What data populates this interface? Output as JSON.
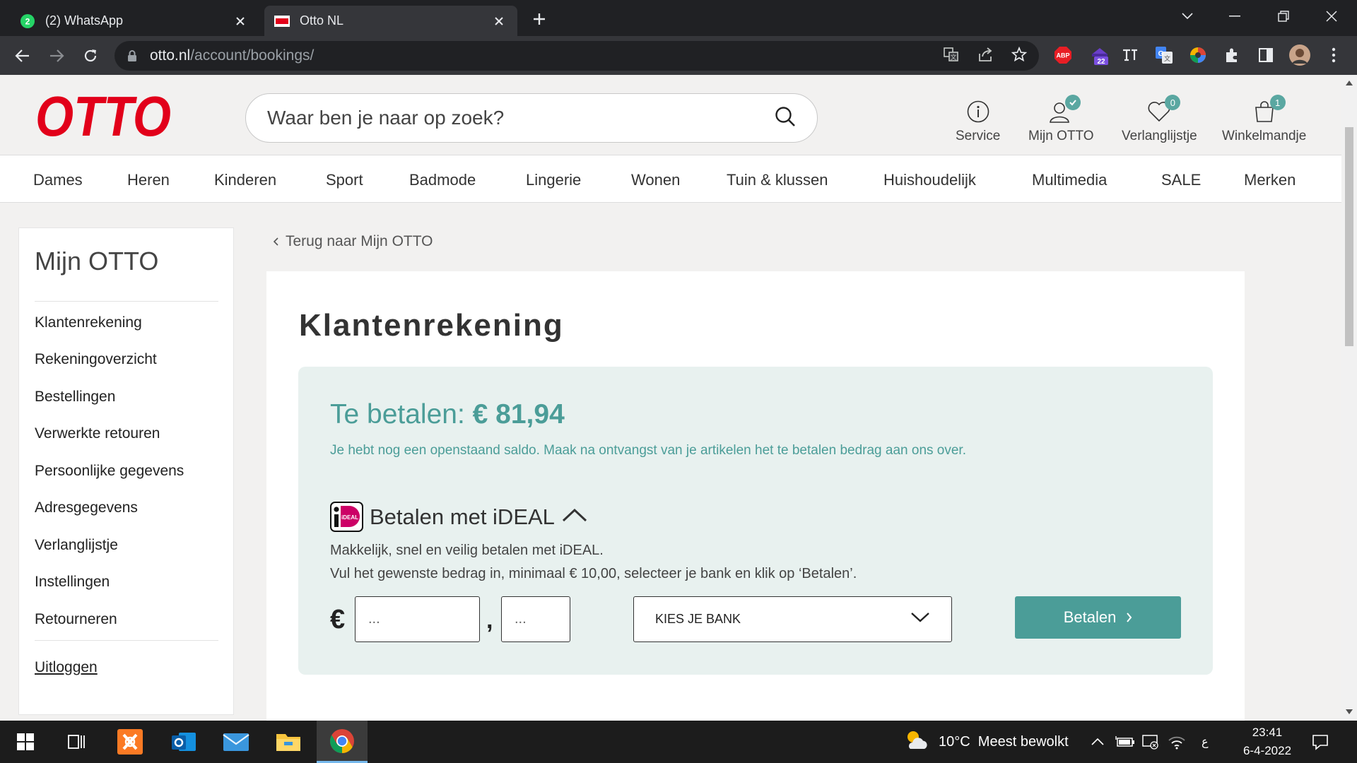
{
  "browser": {
    "tabs": [
      {
        "title": "(2) WhatsApp",
        "favicon": "whatsapp-icon",
        "badge": "2"
      },
      {
        "title": "Otto NL",
        "favicon": "otto-icon",
        "active": true
      }
    ],
    "url_host": "otto.nl",
    "url_path": "/account/bookings/",
    "extensions": {
      "abp": "ABP",
      "count": "22"
    }
  },
  "header": {
    "logo": "OTTO",
    "search_placeholder": "Waar ben je naar op zoek?",
    "icons": [
      {
        "label": "Service",
        "icon": "info-icon"
      },
      {
        "label": "Mijn OTTO",
        "icon": "user-icon"
      },
      {
        "label": "Verlanglijstje",
        "icon": "heart-icon",
        "badge": "0"
      },
      {
        "label": "Winkelmandje",
        "icon": "cart-icon",
        "badge": "1"
      }
    ]
  },
  "categories": [
    "Dames",
    "Heren",
    "Kinderen",
    "Sport",
    "Badmode",
    "Lingerie",
    "Wonen",
    "Tuin & klussen",
    "Huishoudelijk",
    "Multimedia",
    "SALE",
    "Merken"
  ],
  "sidebar": {
    "title": "Mijn OTTO",
    "items": [
      "Klantenrekening",
      "Rekeningoverzicht",
      "Bestellingen",
      "Verwerkte retouren",
      "Persoonlijke gegevens",
      "Adresgegevens",
      "Verlanglijstje",
      "Instellingen",
      "Retourneren"
    ],
    "logout": "Uitloggen"
  },
  "main": {
    "back_link": "Terug naar Mijn OTTO",
    "title": "Klantenrekening",
    "due_label": "Te betalen:",
    "due_amount": "€ 81,94",
    "due_info": "Je hebt nog een openstaand saldo. Maak na ontvangst van je artikelen het te betalen bedrag aan ons over.",
    "ideal_title": "Betalen met iDEAL",
    "ideal_logo_text": "iDEAL",
    "ideal_desc_1": "Makkelijk, snel en veilig betalen met iDEAL.",
    "ideal_desc_2": "Vul het gewenste bedrag in, minimaal € 10,00, selecteer je bank en klik op ‘Betalen’.",
    "currency": "€",
    "comma": ",",
    "euros_placeholder": "...",
    "cents_placeholder": "...",
    "bank_select": "KIES JE BANK",
    "pay_button": "Betalen"
  },
  "taskbar": {
    "weather": "10°C  Meest bewolkt",
    "ime": "ع",
    "time": "23:41",
    "date": "6-4-2022"
  },
  "colors": {
    "otto_red": "#e2001a",
    "teal": "#4b9d98",
    "teal_bg": "#e8f1ef"
  }
}
